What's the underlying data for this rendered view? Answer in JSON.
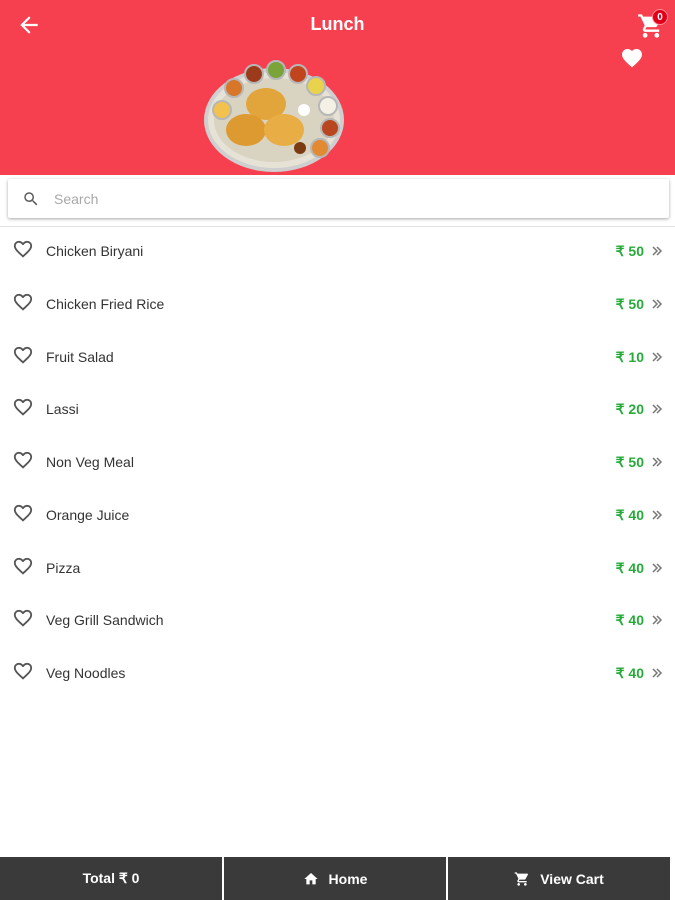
{
  "header": {
    "title": "Lunch",
    "cart_count": "0",
    "background_color": "#f7404f",
    "back_icon": "arrow-left-icon",
    "cart_icon": "cart-icon",
    "favorite_icon": "heart-filled-icon"
  },
  "search": {
    "placeholder": "Search",
    "value": ""
  },
  "menu_items": [
    {
      "name": "Chicken Biryani",
      "price": "₹ 50"
    },
    {
      "name": "Chicken Fried Rice",
      "price": "₹ 50"
    },
    {
      "name": "Fruit Salad",
      "price": "₹ 10"
    },
    {
      "name": "Lassi",
      "price": "₹ 20"
    },
    {
      "name": "Non Veg Meal",
      "price": "₹ 50"
    },
    {
      "name": "Orange Juice",
      "price": "₹ 40"
    },
    {
      "name": "Pizza",
      "price": "₹ 40"
    },
    {
      "name": "Veg Grill Sandwich",
      "price": "₹ 40"
    },
    {
      "name": "Veg Noodles",
      "price": "₹ 40"
    }
  ],
  "price_color": "#27ab3b",
  "bottom_bar": {
    "total_label": "Total ₹ 0",
    "home_label": "Home",
    "view_cart_label": "View Cart",
    "background_color": "#3a3a3a"
  }
}
